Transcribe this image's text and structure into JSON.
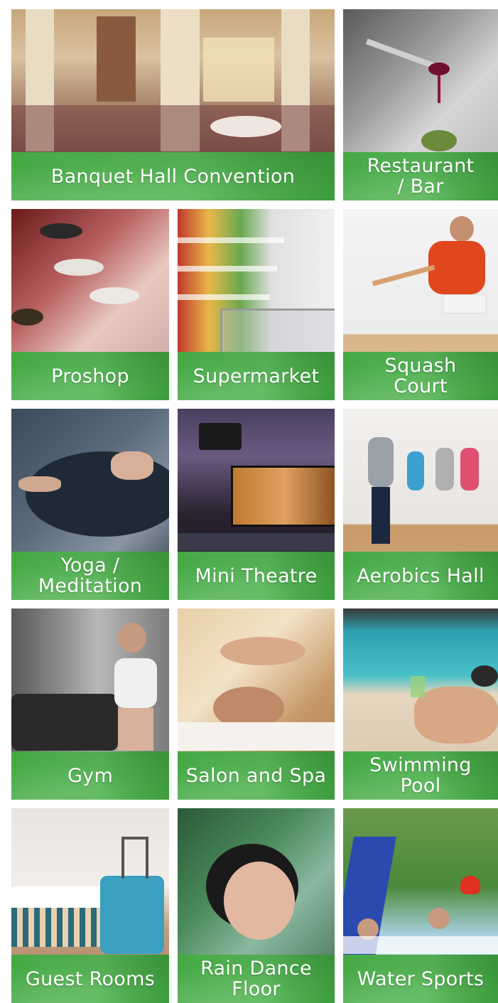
{
  "amenities": [
    {
      "label": "Banquet Hall Convention"
    },
    {
      "label": "Restaurant\n/ Bar"
    },
    {
      "label": "Proshop"
    },
    {
      "label": "Supermarket"
    },
    {
      "label": "Squash\nCourt"
    },
    {
      "label": "Yoga /\nMeditation"
    },
    {
      "label": "Mini Theatre"
    },
    {
      "label": "Aerobics Hall"
    },
    {
      "label": "Gym"
    },
    {
      "label": "Salon and Spa"
    },
    {
      "label": "Swimming\nPool"
    },
    {
      "label": "Guest Rooms"
    },
    {
      "label": "Rain Dance\nFloor"
    },
    {
      "label": "Water Sports"
    }
  ],
  "colors": {
    "band_green": "#4caf50",
    "label_text": "#ffffff"
  }
}
